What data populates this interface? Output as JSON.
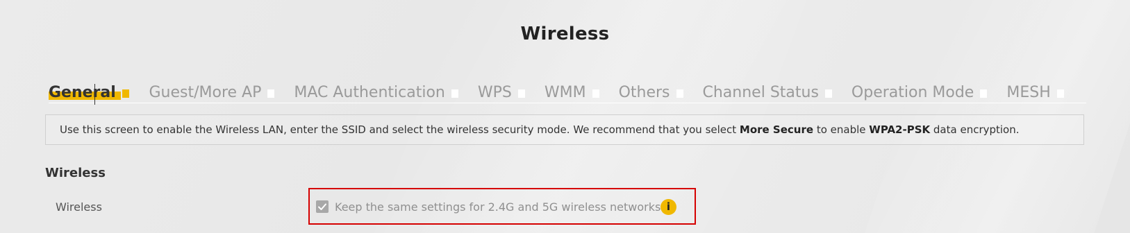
{
  "page": {
    "title": "Wireless"
  },
  "tabs": [
    {
      "label": "General",
      "active": true
    },
    {
      "label": "Guest/More AP",
      "active": false
    },
    {
      "label": "MAC Authentication",
      "active": false
    },
    {
      "label": "WPS",
      "active": false
    },
    {
      "label": "WMM",
      "active": false
    },
    {
      "label": "Others",
      "active": false
    },
    {
      "label": "Channel Status",
      "active": false
    },
    {
      "label": "Operation Mode",
      "active": false
    },
    {
      "label": "MESH",
      "active": false
    }
  ],
  "info": {
    "text_1": "Use this screen to enable the Wireless LAN, enter the SSID and select the wireless security mode. We recommend that you select ",
    "bold_1": "More Secure",
    "text_2": " to enable ",
    "bold_2": "WPA2-PSK",
    "text_3": " data encryption."
  },
  "section": {
    "title": "Wireless"
  },
  "wireless_row": {
    "label": "Wireless",
    "checkbox_label": "Keep the same settings for 2.4G and 5G wireless networks",
    "checked": true,
    "info_icon": "info-icon"
  },
  "colors": {
    "accent": "#f0b800",
    "highlight_border": "#d50000",
    "tab_inactive": "#9a9a9a"
  }
}
